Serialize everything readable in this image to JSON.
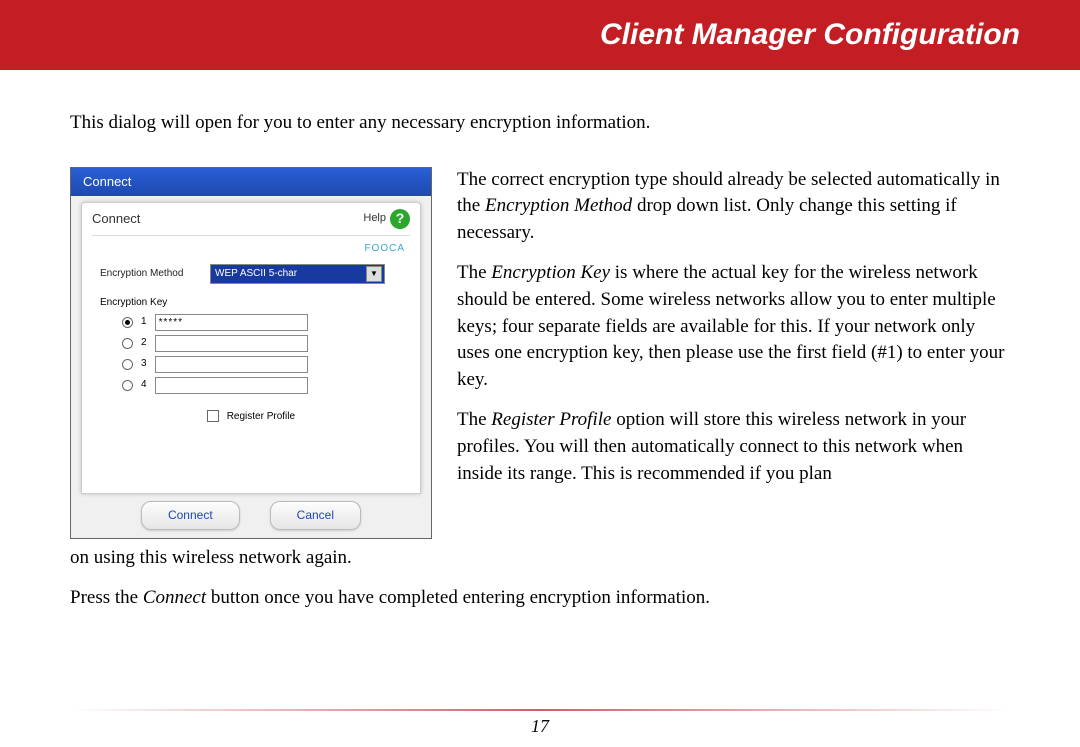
{
  "header": {
    "title": "Client Manager Configuration"
  },
  "page_number": "17",
  "text": {
    "intro": "This dialog will open for you to enter any necessary encryption information.",
    "p1_a": "The correct encryption type should already be selected automatically in the ",
    "p1_em": "Encryption Method",
    "p1_b": " drop down list.  Only change this setting if necessary.",
    "p2_a": "The ",
    "p2_em": "Encryption Key",
    "p2_b": " is where the actual key for the wireless network should be entered.  Some wireless networks allow you to enter multiple keys; four separate fields are available for this.  If your network only uses one encryption key, then please use the first field (#1) to enter your key.",
    "p3_a": "The ",
    "p3_em": "Register Profile",
    "p3_b": " option will store this wireless network in your profiles.  You will then automatically connect to this network when inside its range.  This is recommended if you plan",
    "p3_cont": "on using this wireless network again.",
    "p4_a": "Press the ",
    "p4_em": "Connect",
    "p4_b": " button once you have completed entering encryption information."
  },
  "dialog": {
    "titlebar": "Connect",
    "panel_title": "Connect",
    "help_label": "Help",
    "network_name": "FOOCA",
    "enc_method_label": "Encryption Method",
    "enc_method_value": "WEP ASCII 5-char",
    "enc_key_label": "Encryption Key",
    "keys": [
      {
        "num": "1",
        "checked": true,
        "value": "*****"
      },
      {
        "num": "2",
        "checked": false,
        "value": ""
      },
      {
        "num": "3",
        "checked": false,
        "value": ""
      },
      {
        "num": "4",
        "checked": false,
        "value": ""
      }
    ],
    "register_profile_label": "Register Profile",
    "connect_btn": "Connect",
    "cancel_btn": "Cancel"
  }
}
